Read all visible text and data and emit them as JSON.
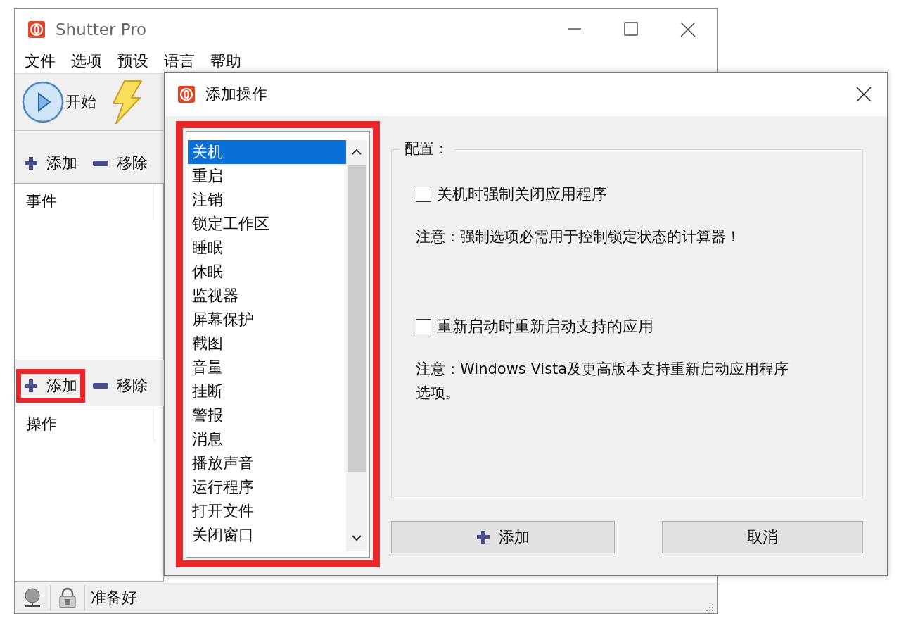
{
  "main_window": {
    "title": "Shutter Pro",
    "menu": [
      "文件",
      "选项",
      "预设",
      "语言",
      "帮助"
    ],
    "toolbar": {
      "start_button": "开始"
    },
    "events": {
      "add_button": {
        "label": "添加",
        "highlighted": false
      },
      "remove_button": "移除",
      "column": "事件"
    },
    "actions": {
      "add_button": {
        "label": "添加",
        "highlighted": true
      },
      "remove_button": "移除",
      "column": "操作"
    },
    "status_bar": {
      "text": "准备好"
    }
  },
  "dialog": {
    "title": "添加操作",
    "list": {
      "highlighted": true,
      "items": [
        {
          "label": "关机",
          "selected": true
        },
        {
          "label": "重启",
          "selected": false
        },
        {
          "label": "注销",
          "selected": false
        },
        {
          "label": "锁定工作区",
          "selected": false
        },
        {
          "label": "睡眠",
          "selected": false
        },
        {
          "label": "休眠",
          "selected": false
        },
        {
          "label": "监视器",
          "selected": false
        },
        {
          "label": "屏幕保护",
          "selected": false
        },
        {
          "label": "截图",
          "selected": false
        },
        {
          "label": "音量",
          "selected": false
        },
        {
          "label": "挂断",
          "selected": false
        },
        {
          "label": "警报",
          "selected": false
        },
        {
          "label": "消息",
          "selected": false
        },
        {
          "label": "播放声音",
          "selected": false
        },
        {
          "label": "运行程序",
          "selected": false
        },
        {
          "label": "打开文件",
          "selected": false
        },
        {
          "label": "关闭窗口",
          "selected": false
        }
      ]
    },
    "config": {
      "title": "配置：",
      "options": [
        {
          "label": "关机时强制关闭应用程序",
          "checked": false,
          "note": "注意：强制选项必需用于控制锁定状态的计算器！"
        },
        {
          "label": "重新启动时重新启动支持的应用",
          "checked": false,
          "note": "注意：Windows Vista及更高版本支持重新启动应用程序选项。"
        }
      ]
    },
    "buttons": [
      {
        "kind": "add",
        "label": "添加"
      },
      {
        "kind": "cancel",
        "label": "取消"
      }
    ]
  }
}
